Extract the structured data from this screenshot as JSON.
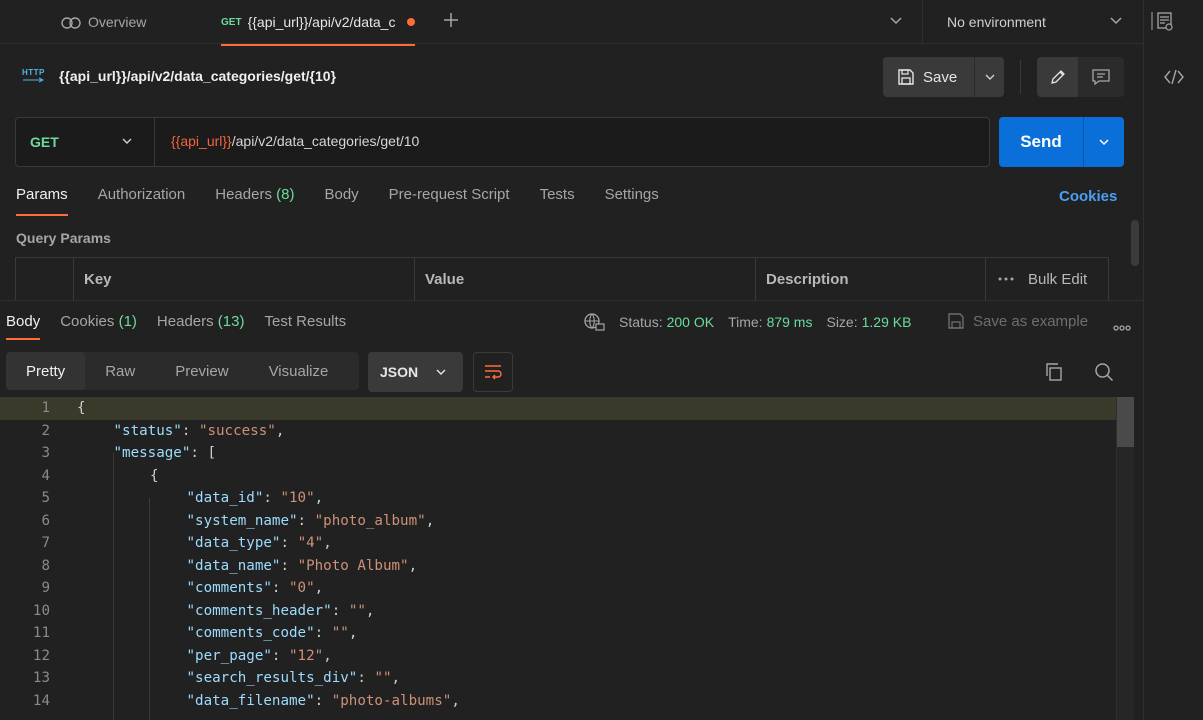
{
  "tabs": {
    "overview_label": "Overview",
    "active": {
      "method": "GET",
      "title": "{{api_url}}/api/v2/data_c"
    }
  },
  "environment": {
    "label": "No environment"
  },
  "request": {
    "title": "{{api_url}}/api/v2/data_categories/get/{10}",
    "protocol_icon_text": "HTTP",
    "save_label": "Save",
    "method": "GET",
    "url_var": "{{api_url}}",
    "url_rest": "/api/v2/data_categories/get/10",
    "send_label": "Send"
  },
  "request_tabs": [
    {
      "label": "Params",
      "count": ""
    },
    {
      "label": "Authorization",
      "count": ""
    },
    {
      "label": "Headers",
      "count": "(8)"
    },
    {
      "label": "Body",
      "count": ""
    },
    {
      "label": "Pre-request Script",
      "count": ""
    },
    {
      "label": "Tests",
      "count": ""
    },
    {
      "label": "Settings",
      "count": ""
    }
  ],
  "cookies_link": "Cookies",
  "query_params": {
    "title": "Query Params",
    "columns": [
      "Key",
      "Value",
      "Description"
    ],
    "bulk_edit": "Bulk Edit"
  },
  "response": {
    "tabs": [
      {
        "label": "Body",
        "count": ""
      },
      {
        "label": "Cookies",
        "count": "(1)"
      },
      {
        "label": "Headers",
        "count": "(13)"
      },
      {
        "label": "Test Results",
        "count": ""
      }
    ],
    "status_label": "Status:",
    "status_value": "200 OK",
    "time_label": "Time:",
    "time_value": "879 ms",
    "size_label": "Size:",
    "size_value": "1.29 KB",
    "save_example": "Save as example",
    "views": [
      "Pretty",
      "Raw",
      "Preview",
      "Visualize"
    ],
    "format": "JSON"
  },
  "code_lines": [
    {
      "n": "1",
      "indent": 0,
      "key": "",
      "val": "",
      "raw": "{"
    },
    {
      "n": "2",
      "indent": 1,
      "key": "\"status\"",
      "val": "\"success\"",
      "raw": ""
    },
    {
      "n": "3",
      "indent": 1,
      "key": "\"message\"",
      "val": "",
      "raw": ": ["
    },
    {
      "n": "4",
      "indent": 2,
      "key": "",
      "val": "",
      "raw": "{"
    },
    {
      "n": "5",
      "indent": 3,
      "key": "\"data_id\"",
      "val": "\"10\"",
      "raw": ""
    },
    {
      "n": "6",
      "indent": 3,
      "key": "\"system_name\"",
      "val": "\"photo_album\"",
      "raw": ""
    },
    {
      "n": "7",
      "indent": 3,
      "key": "\"data_type\"",
      "val": "\"4\"",
      "raw": ""
    },
    {
      "n": "8",
      "indent": 3,
      "key": "\"data_name\"",
      "val": "\"Photo Album\"",
      "raw": ""
    },
    {
      "n": "9",
      "indent": 3,
      "key": "\"comments\"",
      "val": "\"0\"",
      "raw": ""
    },
    {
      "n": "10",
      "indent": 3,
      "key": "\"comments_header\"",
      "val": "\"\"",
      "raw": ""
    },
    {
      "n": "11",
      "indent": 3,
      "key": "\"comments_code\"",
      "val": "\"\"",
      "raw": ""
    },
    {
      "n": "12",
      "indent": 3,
      "key": "\"per_page\"",
      "val": "\"12\"",
      "raw": ""
    },
    {
      "n": "13",
      "indent": 3,
      "key": "\"search_results_div\"",
      "val": "\"\"",
      "raw": ""
    },
    {
      "n": "14",
      "indent": 3,
      "key": "\"data_filename\"",
      "val": "\"photo-albums\"",
      "raw": ""
    }
  ]
}
